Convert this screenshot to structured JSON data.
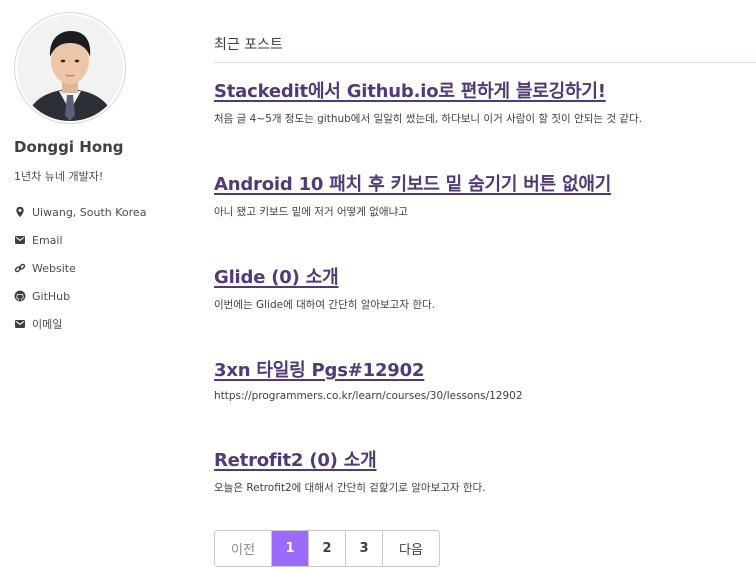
{
  "sidebar": {
    "author_name": "Donggi Hong",
    "author_bio": "1년차 뉴네 개발자!",
    "links": [
      {
        "icon": "map-marker-icon",
        "label": "Uiwang, South Korea"
      },
      {
        "icon": "envelope-icon",
        "label": "Email"
      },
      {
        "icon": "link-icon",
        "label": "Website"
      },
      {
        "icon": "github-icon",
        "label": "GitHub"
      },
      {
        "icon": "envelope-icon",
        "label": "이메일"
      }
    ]
  },
  "main": {
    "section_title": "최근 포스트",
    "posts": [
      {
        "title": "Stackedit에서 Github.io로 편하게 블로깅하기!",
        "excerpt": "처음 글 4~5개 정도는 github에서 일일히 썼는데, 하다보니 이거 사람이 할 짓이 안되는 것 같다."
      },
      {
        "title": "Android 10 패치 후 키보드 밑 숨기기 버튼 없애기",
        "excerpt": "아니 됐고 키보드 밑에 저거 어떻게 없애냐고"
      },
      {
        "title": "Glide (0) 소개",
        "excerpt": "이번에는 Glide에 대하여 간단히 알아보고자 한다."
      },
      {
        "title": "3xn 타일링 Pgs#12902",
        "excerpt": "https://programmers.co.kr/learn/courses/30/lessons/12902"
      },
      {
        "title": "Retrofit2 (0) 소개",
        "excerpt": "오늘은 Retrofit2에 대해서 간단히 겉핥기로 알아보고자 한다."
      }
    ]
  },
  "pagination": {
    "prev_label": "이전",
    "pages": [
      "1",
      "2",
      "3"
    ],
    "current_page": "1",
    "next_label": "다음"
  },
  "colors": {
    "accent": "#9b6bff",
    "link": "#52397a"
  }
}
